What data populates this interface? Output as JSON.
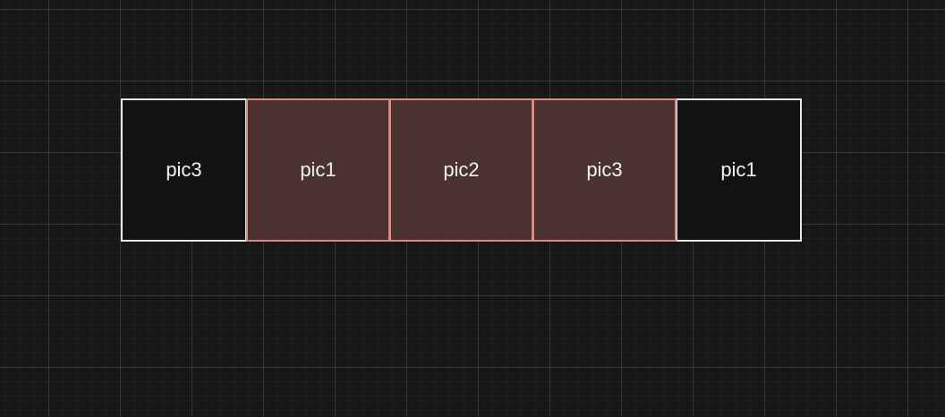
{
  "strip": {
    "cells": [
      {
        "label": "pic3",
        "highlighted": false
      },
      {
        "label": "pic1",
        "highlighted": true
      },
      {
        "label": "pic2",
        "highlighted": true
      },
      {
        "label": "pic3",
        "highlighted": true
      },
      {
        "label": "pic1",
        "highlighted": false
      }
    ]
  },
  "colors": {
    "background": "#171717",
    "cell_plain_fill": "#121212",
    "cell_plain_border": "#e8e8e8",
    "cell_highlight_fill": "#4b3230",
    "cell_highlight_border": "#d88a84",
    "text": "#f2f2f2"
  }
}
